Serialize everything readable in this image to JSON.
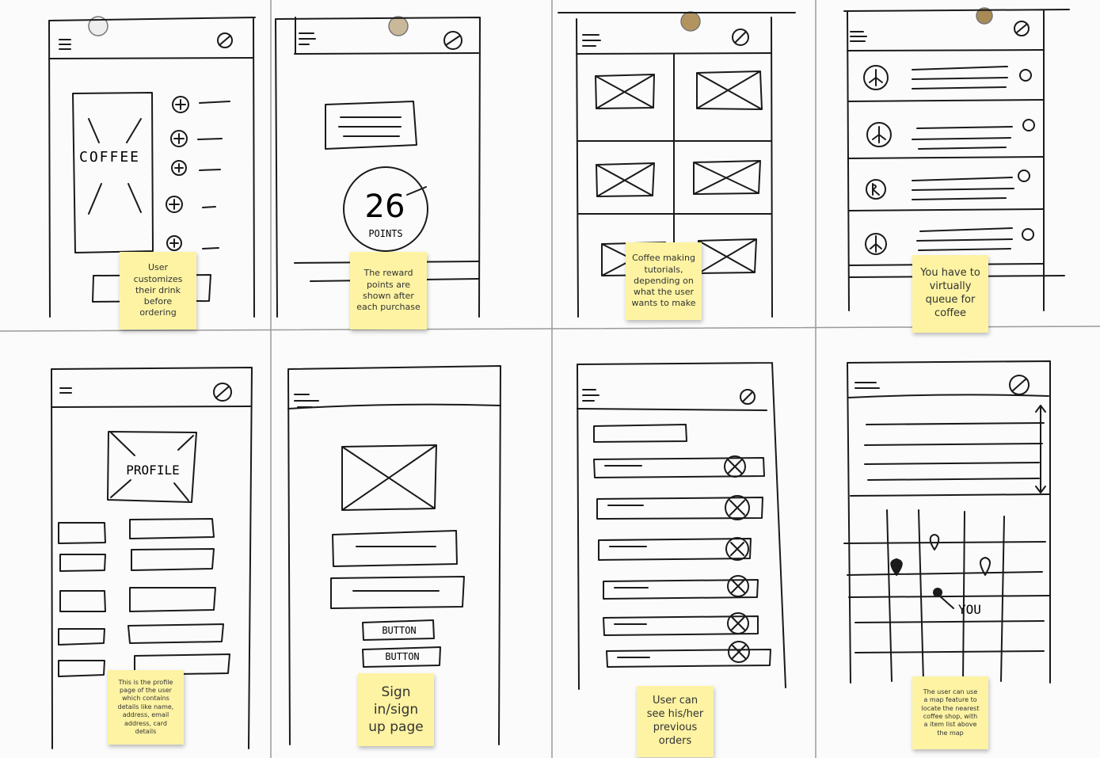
{
  "wireframes": {
    "customize": {
      "label": "COFFEE",
      "note": "User\ncustomizes\ntheir drink\nbefore\nordering"
    },
    "rewards": {
      "points_value": "26",
      "points_label": "POINTS",
      "note": "The reward\npoints are\nshown after\neach purchase"
    },
    "tutorials": {
      "note": "Coffee making\ntutorials,\ndepending on\nwhat the user\nwants to make"
    },
    "queue": {
      "note": "You have to\nvirtually\nqueue for\ncoffee"
    },
    "profile": {
      "label": "PROFILE",
      "note": "This is the profile\npage of the user\nwhich contains\ndetails like name,\naddress, email\naddress, card\ndetails"
    },
    "signin": {
      "button1": "BUTTON",
      "button2": "BUTTON",
      "note": "Sign\nin/sign\nup page"
    },
    "orders": {
      "note": "User can\nsee his/her\nprevious\norders"
    },
    "map": {
      "you_label": "YOU",
      "note": "The user can use\na map feature to\nlocate the nearest\ncoffee shop, with\na item list above\nthe map"
    }
  }
}
